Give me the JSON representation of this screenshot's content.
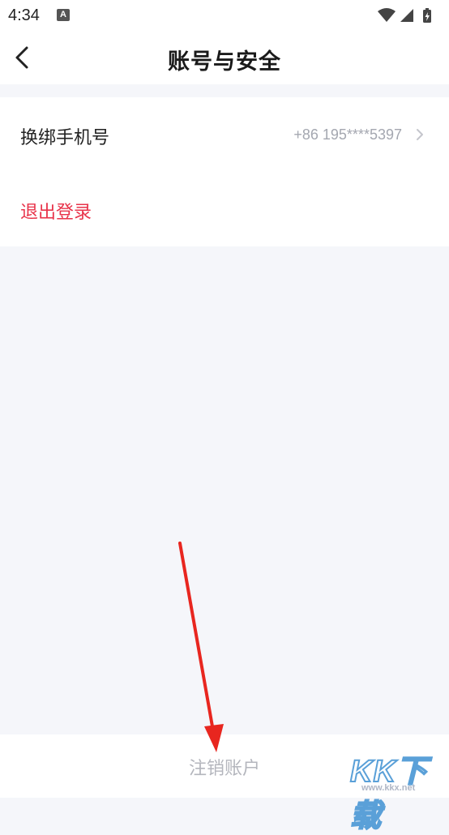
{
  "status_bar": {
    "time": "4:34",
    "notification_icon": "A",
    "icons": [
      "wifi-icon",
      "signal-icon",
      "battery-charging-icon"
    ]
  },
  "header": {
    "title": "账号与安全",
    "back_icon": "chevron-left-icon"
  },
  "settings": {
    "phone_row": {
      "label": "换绑手机号",
      "value": "+86 195****5397",
      "chevron_icon": "chevron-right-icon"
    },
    "logout_row": {
      "label": "退出登录"
    }
  },
  "footer": {
    "cancel_account_label": "注销账户"
  },
  "watermark": {
    "brand": "KK下载",
    "url": "www.kkx.net"
  },
  "colors": {
    "background": "#f5f6fa",
    "danger": "#e8334a",
    "muted": "#a4a7b0",
    "annotation_arrow": "#e8261f"
  }
}
